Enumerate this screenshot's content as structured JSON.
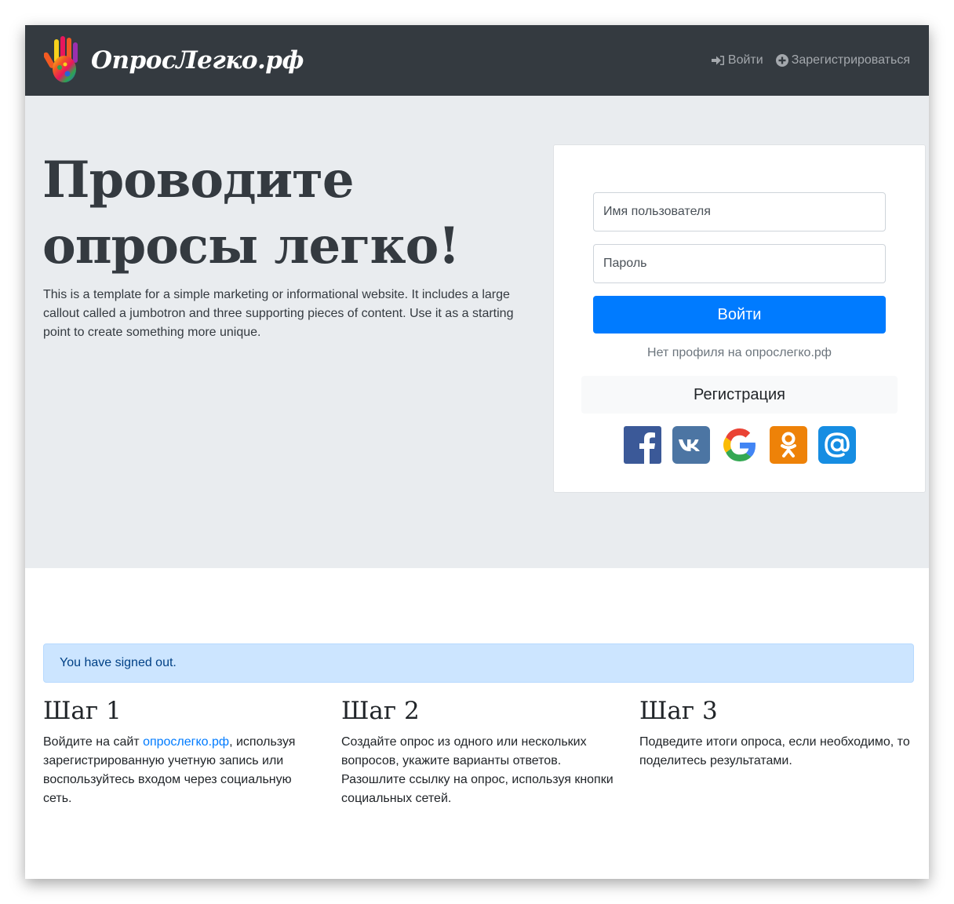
{
  "navbar": {
    "brand": "ОпросЛегко.рф",
    "login_label": "Войти",
    "register_label": "Зарегистрироваться"
  },
  "hero": {
    "title_line1": "Проводите",
    "title_line2": "опросы легко!",
    "text": "This is a template for a simple marketing or informational website. It includes a large callout called a jumbotron and three supporting pieces of content. Use it as a starting point to create something more unique."
  },
  "login_form": {
    "username_placeholder": "Имя пользователя",
    "username_value": "",
    "password_placeholder": "Пароль",
    "password_value": "",
    "submit_label": "Войти",
    "no_profile_text": "Нет профиля на опрослегко.рф",
    "register_label": "Регистрация",
    "socials": [
      {
        "name": "facebook",
        "icon": "facebook-icon",
        "color": "#3b5998"
      },
      {
        "name": "vkontakte",
        "icon": "vk-icon",
        "color": "#4c75a3"
      },
      {
        "name": "google",
        "icon": "google-icon",
        "color": "#4285f4"
      },
      {
        "name": "odnoklassniki",
        "icon": "ok-icon",
        "color": "#ee8208"
      },
      {
        "name": "mail.ru",
        "icon": "at-icon",
        "color": "#168de2"
      }
    ]
  },
  "alert": {
    "text": "You have signed out."
  },
  "steps": [
    {
      "title": "Шаг 1",
      "text_before": "Войдите на сайт ",
      "link": "опрослегко.рф",
      "text_after": ", используя зарегистрированную учетную запись или воспользуйтесь входом через социальную сеть."
    },
    {
      "title": "Шаг 2",
      "text": "Создайте опрос из одного или нескольких вопросов, укажите варианты ответов. Разошлите ссылку на опрос, используя кнопки социальных сетей."
    },
    {
      "title": "Шаг 3",
      "text": "Подведите итоги опроса, если необходимо, то поделитесь результатами."
    }
  ],
  "colors": {
    "navbar": "#343a40",
    "jumbotron": "#e9ecef",
    "primary": "#007bff",
    "alert_bg": "#cce5ff",
    "alert_text": "#004085"
  }
}
